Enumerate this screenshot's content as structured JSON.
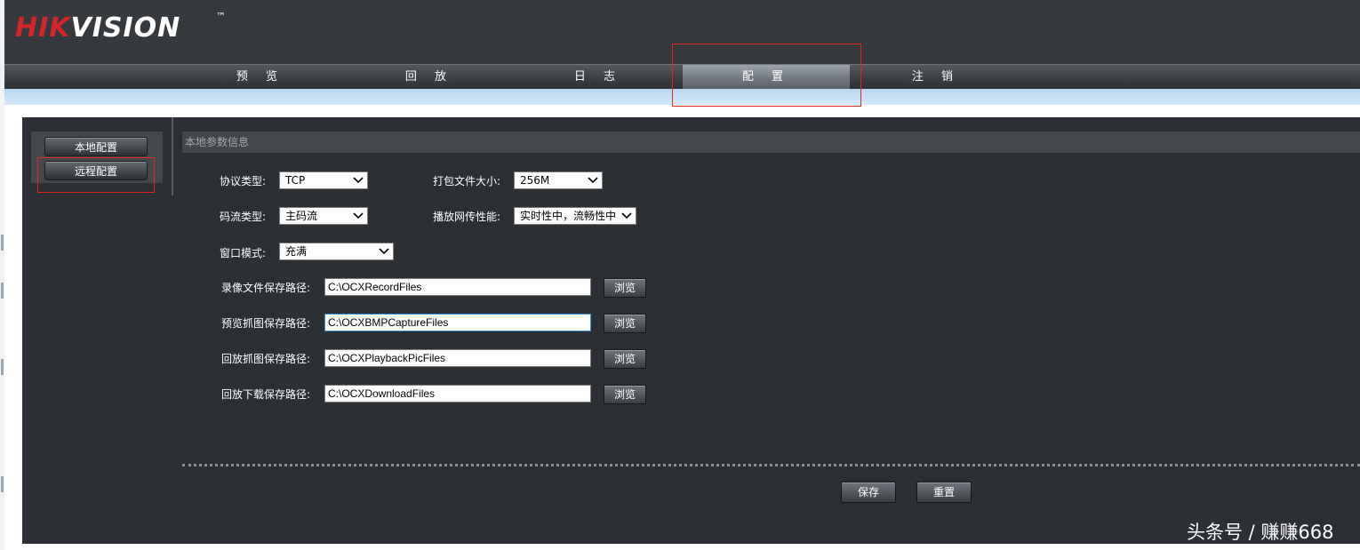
{
  "brand": {
    "logo_left": "HIK",
    "logo_right": "VISION",
    "trademark": "™"
  },
  "nav": {
    "items": [
      "预 览",
      "回 放",
      "日 志",
      "配 置",
      "注 销"
    ],
    "active": "配 置"
  },
  "sidebar": {
    "items": [
      "本地配置",
      "远程配置"
    ]
  },
  "section": {
    "title": "本地参数信息"
  },
  "form": {
    "protocol_label": "协议类型:",
    "protocol_value": "TCP",
    "package_size_label": "打包文件大小:",
    "package_size_value": "256M",
    "stream_label": "码流类型:",
    "stream_value": "主码流",
    "net_perf_label": "播放网传性能:",
    "net_perf_value": "实时性中，流畅性中",
    "window_mode_label": "窗口模式:",
    "window_mode_value": "充满",
    "record_path_label": "录像文件保存路径:",
    "record_path_value": "C:\\OCXRecordFiles",
    "capture_path_label": "预览抓图保存路径:",
    "capture_path_value": "C:\\OCXBMPCaptureFiles",
    "playback_pic_label": "回放抓图保存路径:",
    "playback_pic_value": "C:\\OCXPlaybackPicFiles",
    "download_path_label": "回放下载保存路径:",
    "download_path_value": "C:\\OCXDownloadFiles",
    "browse_label": "浏览"
  },
  "actions": {
    "save": "保存",
    "reset": "重置"
  },
  "watermark": "头条号 / 赚赚668",
  "colors": {
    "brand_red": "#d1252a",
    "panel_bg": "#2c3035",
    "highlight_box": "#e0241f"
  }
}
